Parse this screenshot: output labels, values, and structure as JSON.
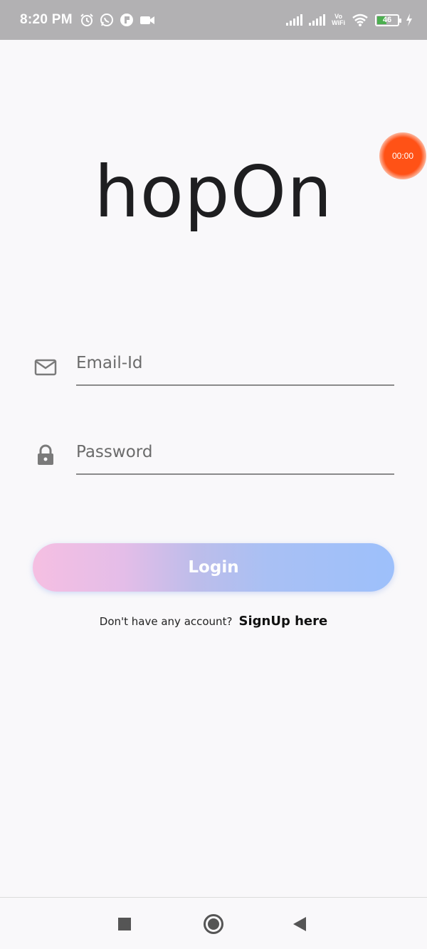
{
  "status_bar": {
    "time": "8:20 PM",
    "left_icons": [
      "alarm-icon",
      "whatsapp-icon",
      "app-notification-icon",
      "video-camera-icon"
    ],
    "right_icons": [
      "signal-icon",
      "signal-icon",
      "vowifi-icon",
      "wifi-icon",
      "battery-icon",
      "charging-icon"
    ],
    "vowifi_top": "Vo",
    "vowifi_bottom": "WiFi",
    "battery_level": "46",
    "battery_fraction": 0.46,
    "battery_color": "#4caf50"
  },
  "recorder": {
    "timer": "00:00",
    "color": "#ff5216"
  },
  "app": {
    "logo": "hopOn"
  },
  "form": {
    "email_placeholder": "Email-Id",
    "email_value": "",
    "password_placeholder": "Password",
    "password_value": "",
    "login_label": "Login",
    "login_gradient": [
      "#f5bfe2",
      "#9dc0fb"
    ],
    "signup_prompt": "Don't have any account?",
    "signup_link": "SignUp here"
  },
  "nav_bar": {
    "buttons": [
      "recents-button",
      "home-button",
      "back-button"
    ]
  }
}
